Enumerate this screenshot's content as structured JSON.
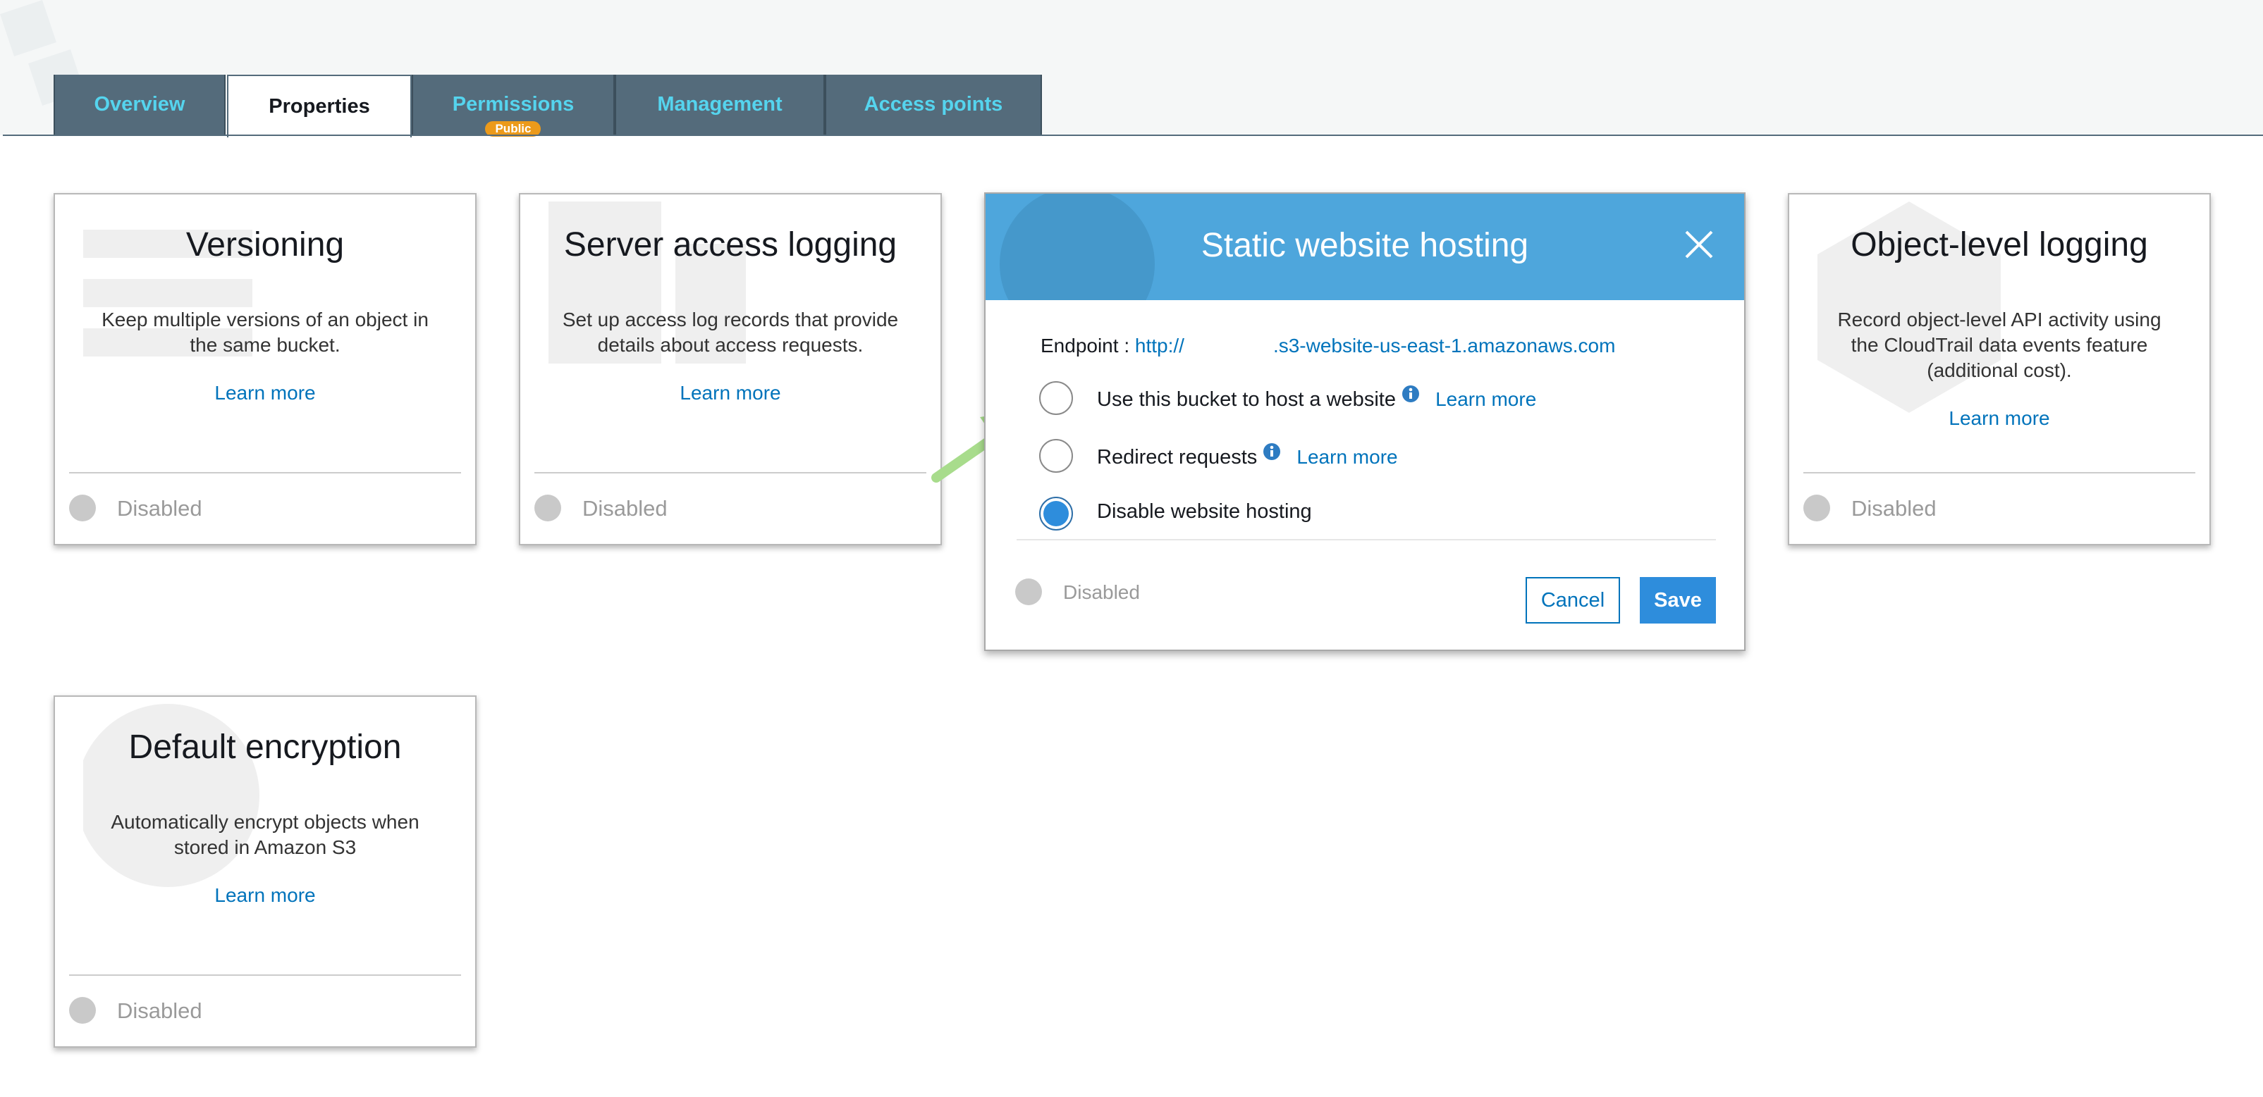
{
  "tabs": [
    {
      "label": "Overview",
      "active": false
    },
    {
      "label": "Properties",
      "active": true
    },
    {
      "label": "Permissions",
      "active": false,
      "badge": "Public"
    },
    {
      "label": "Management",
      "active": false
    },
    {
      "label": "Access points",
      "active": false
    }
  ],
  "cards": {
    "versioning": {
      "title": "Versioning",
      "description": "Keep multiple versions of an object in the same bucket.",
      "learn_more": "Learn more",
      "status": "Disabled"
    },
    "server_access_logging": {
      "title": "Server access logging",
      "description": "Set up access log records that provide details about access requests.",
      "learn_more": "Learn more",
      "status": "Disabled"
    },
    "object_level_logging": {
      "title": "Object-level logging",
      "description": "Record object-level API activity using the CloudTrail data events feature (additional cost).",
      "learn_more": "Learn more",
      "status": "Disabled"
    },
    "default_encryption": {
      "title": "Default encryption",
      "description": "Automatically encrypt objects when stored in Amazon S3",
      "learn_more": "Learn more",
      "status": "Disabled"
    }
  },
  "static_hosting": {
    "title": "Static website hosting",
    "endpoint_label": "Endpoint :",
    "endpoint_prefix": "http://",
    "endpoint_suffix": ".s3-website-us-east-1.amazonaws.com",
    "options": [
      {
        "label": "Use this bucket to host a website",
        "info": true,
        "learn_more": "Learn more",
        "checked": false
      },
      {
        "label": "Redirect requests",
        "info": true,
        "learn_more": "Learn more",
        "checked": false
      },
      {
        "label": "Disable website hosting",
        "info": false,
        "learn_more": "",
        "checked": true
      }
    ],
    "status": "Disabled",
    "cancel_label": "Cancel",
    "save_label": "Save"
  },
  "colors": {
    "tab_bg": "#546b7b",
    "tab_text": "#55d4ee",
    "link": "#0073bb",
    "header_blue": "#4ea6dc",
    "save_blue": "#2e8ddc",
    "badge_orange": "#ec9a1a",
    "arrow_green": "#a8dc8c"
  },
  "icons": {
    "close": "close-icon",
    "info": "info-icon",
    "status": "status-dot-icon",
    "arrow": "annotation-arrow"
  }
}
